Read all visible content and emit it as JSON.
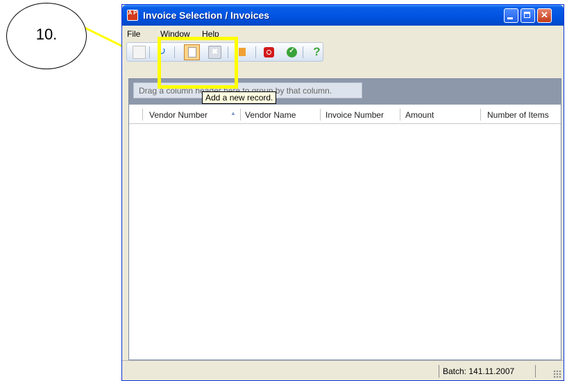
{
  "callout": {
    "number": "10."
  },
  "window": {
    "title": "Invoice Selection / Invoices",
    "app_icon": "A P"
  },
  "menu": {
    "items": [
      {
        "label": "File"
      },
      {
        "label": "Window"
      },
      {
        "label": "Help"
      }
    ]
  },
  "toolbar": {
    "buttons": [
      {
        "name": "edit",
        "icon": "edit-icon"
      },
      {
        "name": "refresh",
        "icon": "refresh-icon"
      },
      {
        "name": "new",
        "icon": "new-document-icon"
      },
      {
        "name": "delete",
        "icon": "delete-icon"
      },
      {
        "name": "flag",
        "icon": "flag-icon"
      },
      {
        "name": "stop",
        "icon": "stop-icon"
      },
      {
        "name": "ok",
        "icon": "ok-icon"
      },
      {
        "name": "help",
        "icon": "help-icon"
      }
    ]
  },
  "tooltip": {
    "text": "Add a new record."
  },
  "grid": {
    "group_hint": "Drag a column header here to group by that column.",
    "columns": [
      {
        "label": "Vendor Number",
        "sorted": "ascending"
      },
      {
        "label": "Vendor Name"
      },
      {
        "label": "Invoice Number"
      },
      {
        "label": "Amount"
      },
      {
        "label": "Number of Items"
      }
    ],
    "rows": []
  },
  "status": {
    "batch": "Batch: 141.11.2007"
  },
  "colors": {
    "highlight": "#ffff00",
    "titlebar": "#0053e1"
  }
}
